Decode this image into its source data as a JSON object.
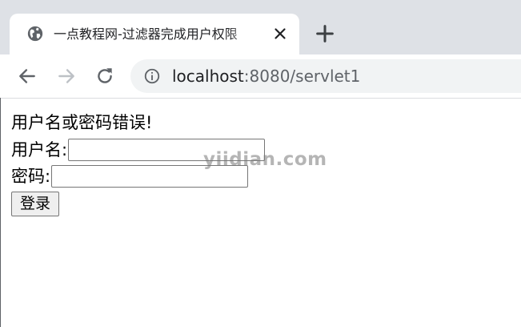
{
  "browser": {
    "tab": {
      "title": "一点教程网-过滤器完成用户权限"
    },
    "address_bar": {
      "host": "localhost",
      "rest": ":8080/servlet1"
    }
  },
  "page": {
    "error_message": "用户名或密码错误!",
    "username_label": "用户名:",
    "username_value": "",
    "password_label": "密码:",
    "password_value": "",
    "login_button": "登录",
    "watermark": "yiidian.com"
  },
  "colors": {
    "tabstrip_bg": "#dee1e6",
    "omnibox_bg": "#f1f3f4",
    "icon_gray": "#5f6368"
  },
  "icons": [
    "globe-icon",
    "close-icon",
    "plus-icon",
    "back-arrow-icon",
    "forward-arrow-icon",
    "reload-icon",
    "info-icon"
  ]
}
